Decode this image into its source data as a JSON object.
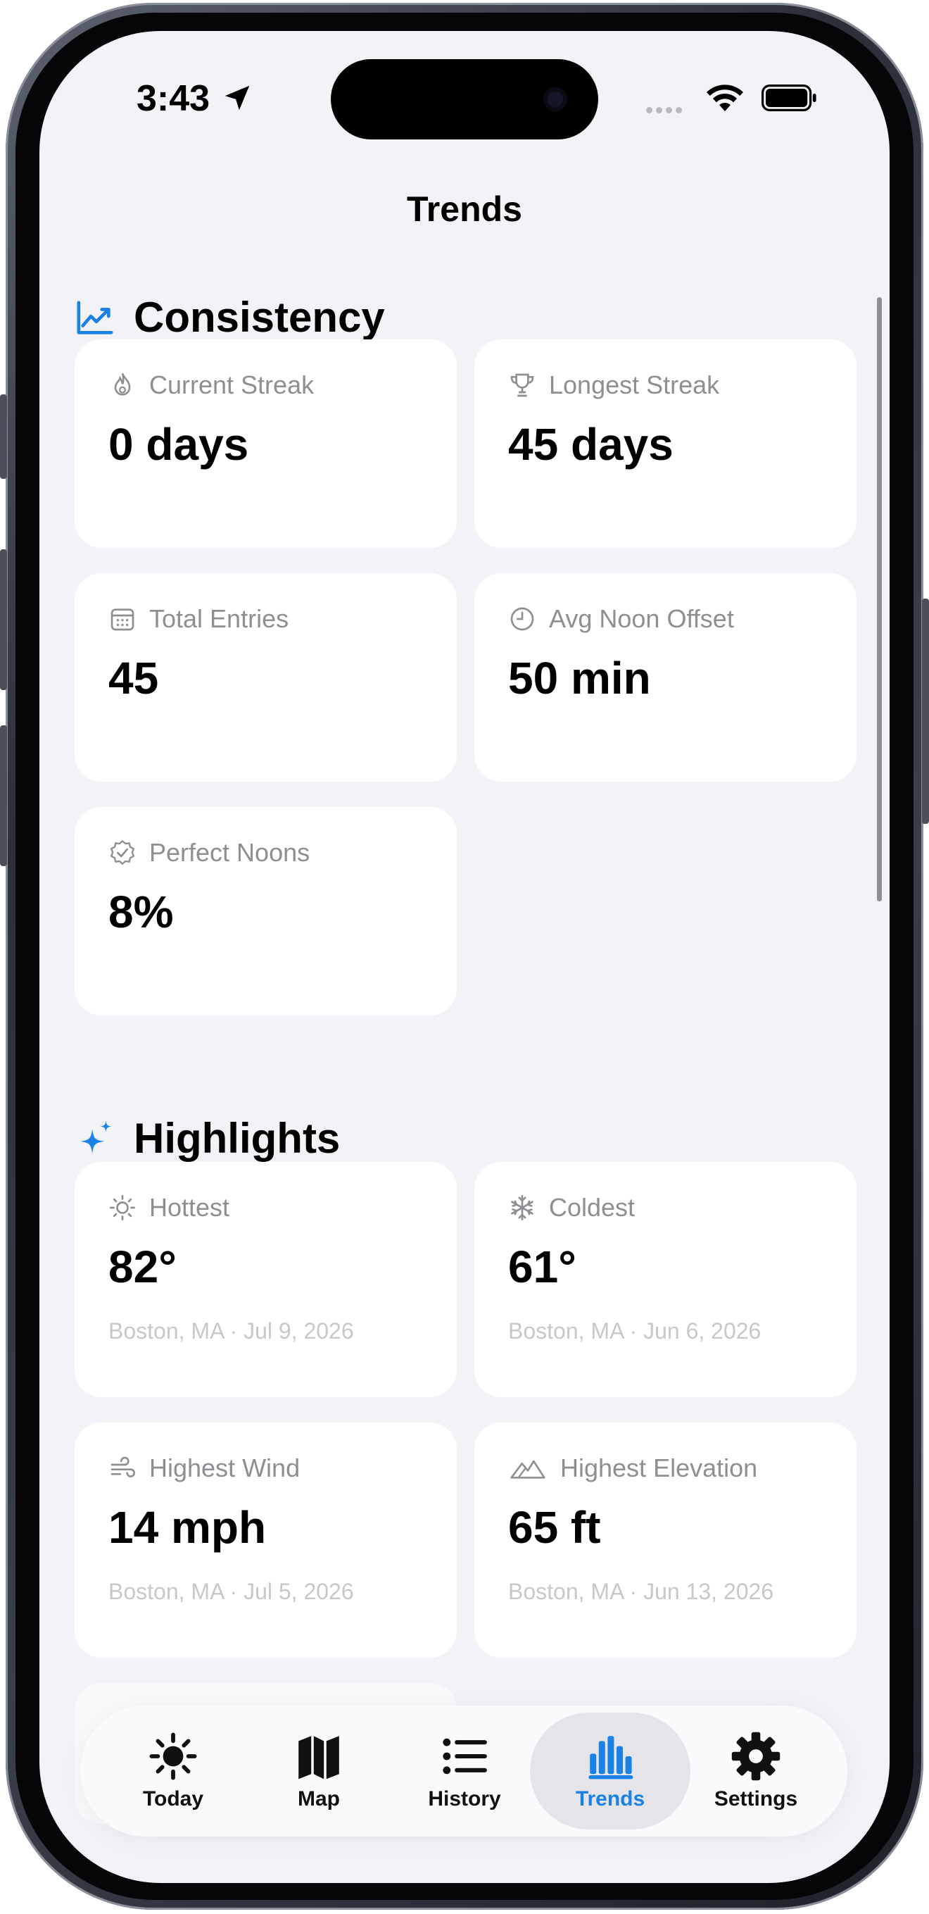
{
  "status": {
    "time": "3:43"
  },
  "nav": {
    "title": "Trends"
  },
  "colors": {
    "accent": "#1a82e6",
    "background": "#f2f2f7",
    "card": "#ffffff",
    "secondary_text": "#8e8e93"
  },
  "consistency": {
    "title": "Consistency",
    "icon": "chart-line-uptrend-icon",
    "cards": [
      {
        "icon": "flame-icon",
        "label": "Current Streak",
        "value": "0 days"
      },
      {
        "icon": "trophy-icon",
        "label": "Longest Streak",
        "value": "45 days"
      },
      {
        "icon": "calendar-icon",
        "label": "Total Entries",
        "value": "45"
      },
      {
        "icon": "clock-icon",
        "label": "Avg Noon Offset",
        "value": "50 min"
      },
      {
        "icon": "checkmark-seal-icon",
        "label": "Perfect Noons",
        "value": "8%"
      }
    ]
  },
  "highlights": {
    "title": "Highlights",
    "icon": "sparkles-icon",
    "cards": [
      {
        "icon": "sun-icon",
        "label": "Hottest",
        "value": "82°",
        "detail": "Boston, MA · Jul 9, 2026"
      },
      {
        "icon": "snowflake-icon",
        "label": "Coldest",
        "value": "61°",
        "detail": "Boston, MA · Jun 6, 2026"
      },
      {
        "icon": "wind-icon",
        "label": "Highest Wind",
        "value": "14 mph",
        "detail": "Boston, MA · Jul 5, 2026"
      },
      {
        "icon": "mountain-icon",
        "label": "Highest Elevation",
        "value": "65 ft",
        "detail": "Boston, MA · Jun 13, 2026"
      }
    ]
  },
  "tabbar": {
    "selected": "Trends",
    "tabs": [
      {
        "label": "Today",
        "icon": "sun-max-icon"
      },
      {
        "label": "Map",
        "icon": "map-icon"
      },
      {
        "label": "History",
        "icon": "list-bullet-icon"
      },
      {
        "label": "Trends",
        "icon": "chart-bar-icon"
      },
      {
        "label": "Settings",
        "icon": "gear-icon"
      }
    ]
  }
}
